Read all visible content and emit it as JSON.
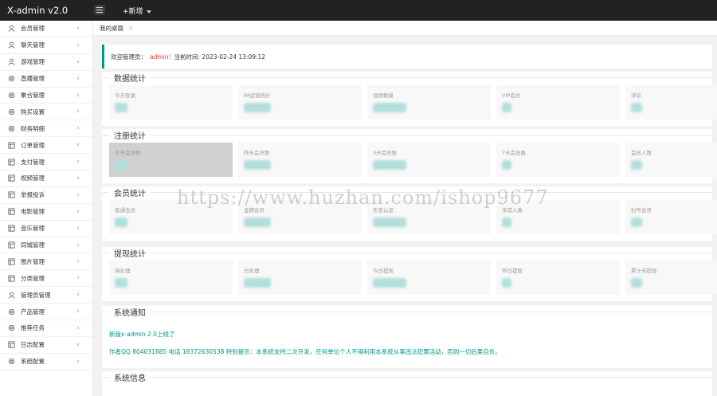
{
  "app": {
    "title": "X-admin v2.0",
    "add_label": "+新增"
  },
  "sidebar": {
    "items": [
      {
        "label": "会员管理",
        "icon": "user-icon"
      },
      {
        "label": "聊天管理",
        "icon": "user-icon"
      },
      {
        "label": "游戏管理",
        "icon": "user-icon"
      },
      {
        "label": "直播管理",
        "icon": "gear-icon"
      },
      {
        "label": "聚合管理",
        "icon": "gear-icon"
      },
      {
        "label": "购买设置",
        "icon": "gear-icon"
      },
      {
        "label": "财务明细",
        "icon": "gear-icon"
      },
      {
        "label": "订单管理",
        "icon": "list-icon"
      },
      {
        "label": "支付管理",
        "icon": "list-icon"
      },
      {
        "label": "视频管理",
        "icon": "list-icon"
      },
      {
        "label": "举报投诉",
        "icon": "list-icon"
      },
      {
        "label": "电影管理",
        "icon": "list-icon"
      },
      {
        "label": "音乐管理",
        "icon": "list-icon"
      },
      {
        "label": "同城管理",
        "icon": "list-icon"
      },
      {
        "label": "图片管理",
        "icon": "list-icon"
      },
      {
        "label": "分类管理",
        "icon": "list-icon"
      },
      {
        "label": "管理员管理",
        "icon": "user-icon"
      },
      {
        "label": "产品管理",
        "icon": "gear-icon"
      },
      {
        "label": "推荐任务",
        "icon": "gear-icon"
      },
      {
        "label": "日志配置",
        "icon": "list-icon"
      },
      {
        "label": "系统配置",
        "icon": "gear-icon"
      }
    ]
  },
  "tabs": [
    {
      "label": "我的桌面",
      "close": "×"
    }
  ],
  "welcome": {
    "prefix": "欢迎管理员：",
    "user": "admin!",
    "time": "当前时间: 2023-02-24 13:09:12"
  },
  "sections": {
    "data_stats": {
      "title": "数据统计",
      "cards": [
        "今天登录",
        "IM运营统计",
        "视频数量",
        "VIP会员",
        "评论"
      ]
    },
    "reg_stats": {
      "title": "注册统计",
      "cards": [
        "今天会员数",
        "昨天会员数",
        "3天会员数",
        "7天会员数",
        "会员人数"
      ]
    },
    "member_stats": {
      "title": "会员统计",
      "cards": [
        "普通会员",
        "金牌会员",
        "实名认证",
        "未成人数",
        "封号会员"
      ]
    },
    "withdraw_stats": {
      "title": "提现统计",
      "cards": [
        "待处理",
        "已处理",
        "今日提现",
        "昨日提现",
        "累计未提现"
      ]
    },
    "notice": {
      "title": "系统通知",
      "line1": "新版x-admin 2.0上线了",
      "line2": "作者QQ 804031885 电话 18372630538 特别提示：本系统支持二次开发，任何单位个人不得利用本系统从事违法犯罪活动，否则一切后果自负。"
    },
    "sysinfo": {
      "title": "系统信息"
    }
  },
  "watermark": "https://www.huzhan.com/ishop9677",
  "colors": {
    "accent": "#009688",
    "topbar": "#222222",
    "highlight": "#e53935"
  }
}
